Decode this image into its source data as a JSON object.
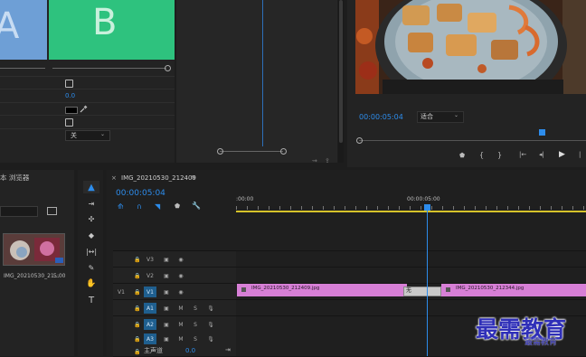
{
  "source_monitor": {
    "tile_a_letter": "A",
    "tile_b_letter": "B",
    "opacity_value": "0.0",
    "dropdown_value": "关"
  },
  "program_monitor": {
    "timecode": "00:00:05:04",
    "fit_label": "适合"
  },
  "project_panel": {
    "title_fragment": "本 浏览器",
    "clip_name": "IMG_20210530_21...",
    "clip_duration": "5:00"
  },
  "sequence": {
    "close_glyph": "×",
    "name": "IMG_20210530_212409",
    "menu_glyph": "≡",
    "timecode": "00:00:05:04",
    "ruler_start": ":00:00",
    "ruler_mid": "00:00:05:00"
  },
  "tracks": {
    "video": [
      {
        "source": "",
        "label": "V3"
      },
      {
        "source": "",
        "label": "V2"
      },
      {
        "source": "V1",
        "label": "V1"
      }
    ],
    "audio": [
      {
        "label": "A1",
        "m": "M",
        "s": "S"
      },
      {
        "label": "A2",
        "m": "M",
        "s": "S"
      },
      {
        "label": "A3",
        "m": "M",
        "s": "S"
      }
    ],
    "master_label": "主声道",
    "master_value": "0.0"
  },
  "clips": {
    "clip1_name": "IMG_20210530_212409.jpg",
    "clip2_name": "IMG_20210530_212344.jpg",
    "transition_label": "无"
  },
  "watermark": {
    "text": "最需教育",
    "subtext": "最需教育"
  },
  "colors": {
    "accent": "#2d8ceb",
    "clip_pink": "#d77fd6",
    "tile_blue": "#6e9fd6",
    "tile_green": "#2ec27e",
    "ruler_yellow": "#d6c22a"
  }
}
